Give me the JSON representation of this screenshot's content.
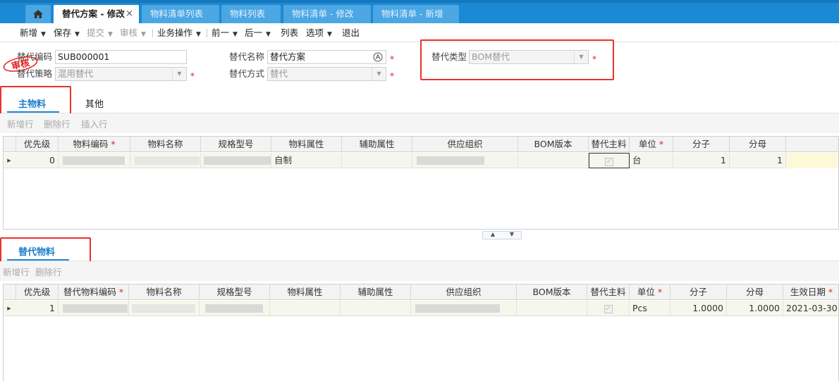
{
  "tabs": [
    {
      "label": "替代方案 - 修改",
      "active": true
    },
    {
      "label": "物料清单列表"
    },
    {
      "label": "物料列表"
    },
    {
      "label": "物料清单 - 修改"
    },
    {
      "label": "物料清单 - 新增"
    }
  ],
  "tab_close": "×",
  "home_icon": "home-icon",
  "toolbar": {
    "new": "新增",
    "save": "保存",
    "submit": "提交",
    "audit": "审核",
    "business": "业务操作",
    "prev": "前一",
    "next": "后一",
    "list": "列表",
    "options": "选项",
    "exit": "退出",
    "arrow": "▼"
  },
  "form": {
    "code_label": "替代编码",
    "code_value": "SUB000001",
    "name_label": "替代名称",
    "name_value": "替代方案",
    "type_label": "替代类型",
    "type_value": "BOM替代",
    "strategy_label": "替代策略",
    "strategy_value": "混用替代",
    "method_label": "替代方式",
    "method_value": "替代",
    "required_mark": "*",
    "stamp_text": "审核",
    "multilang_icon": "translate-icon"
  },
  "section_tabs": {
    "main": "主物料",
    "other": "其他"
  },
  "main_actions": {
    "add_row": "新增行",
    "delete_row": "删除行",
    "insert_row": "插入行"
  },
  "main_grid": {
    "headers": [
      "优先级",
      "物料编码",
      "物料名称",
      "规格型号",
      "物料属性",
      "辅助属性",
      "供应组织",
      "BOM版本",
      "替代主料",
      "单位",
      "分子",
      "分母"
    ],
    "required_headers": [
      "物料编码",
      "单位"
    ],
    "rows": [
      {
        "priority": "0",
        "material_attr": "自制",
        "main_flag": "✓",
        "unit": "台",
        "numerator": "1",
        "denominator": "1"
      }
    ]
  },
  "substitute_section": {
    "title": "替代物料"
  },
  "sub_actions": {
    "add_row": "新增行",
    "delete_row": "删除行"
  },
  "sub_grid": {
    "headers": [
      "优先级",
      "替代物料编码",
      "物料名称",
      "规格型号",
      "物料属性",
      "辅助属性",
      "供应组织",
      "BOM版本",
      "替代主料",
      "单位",
      "分子",
      "分母",
      "生效日期"
    ],
    "required_headers": [
      "替代物料编码",
      "单位",
      "生效日期"
    ],
    "rows": [
      {
        "priority": "1",
        "main_flag": "✓",
        "unit": "Pcs",
        "numerator": "1.0000",
        "denominator": "1.0000",
        "effective_date": "2021-03-30"
      }
    ]
  },
  "colors": {
    "accent": "#1b89d4",
    "highlight": "#e8322d",
    "required": "#e02020"
  }
}
